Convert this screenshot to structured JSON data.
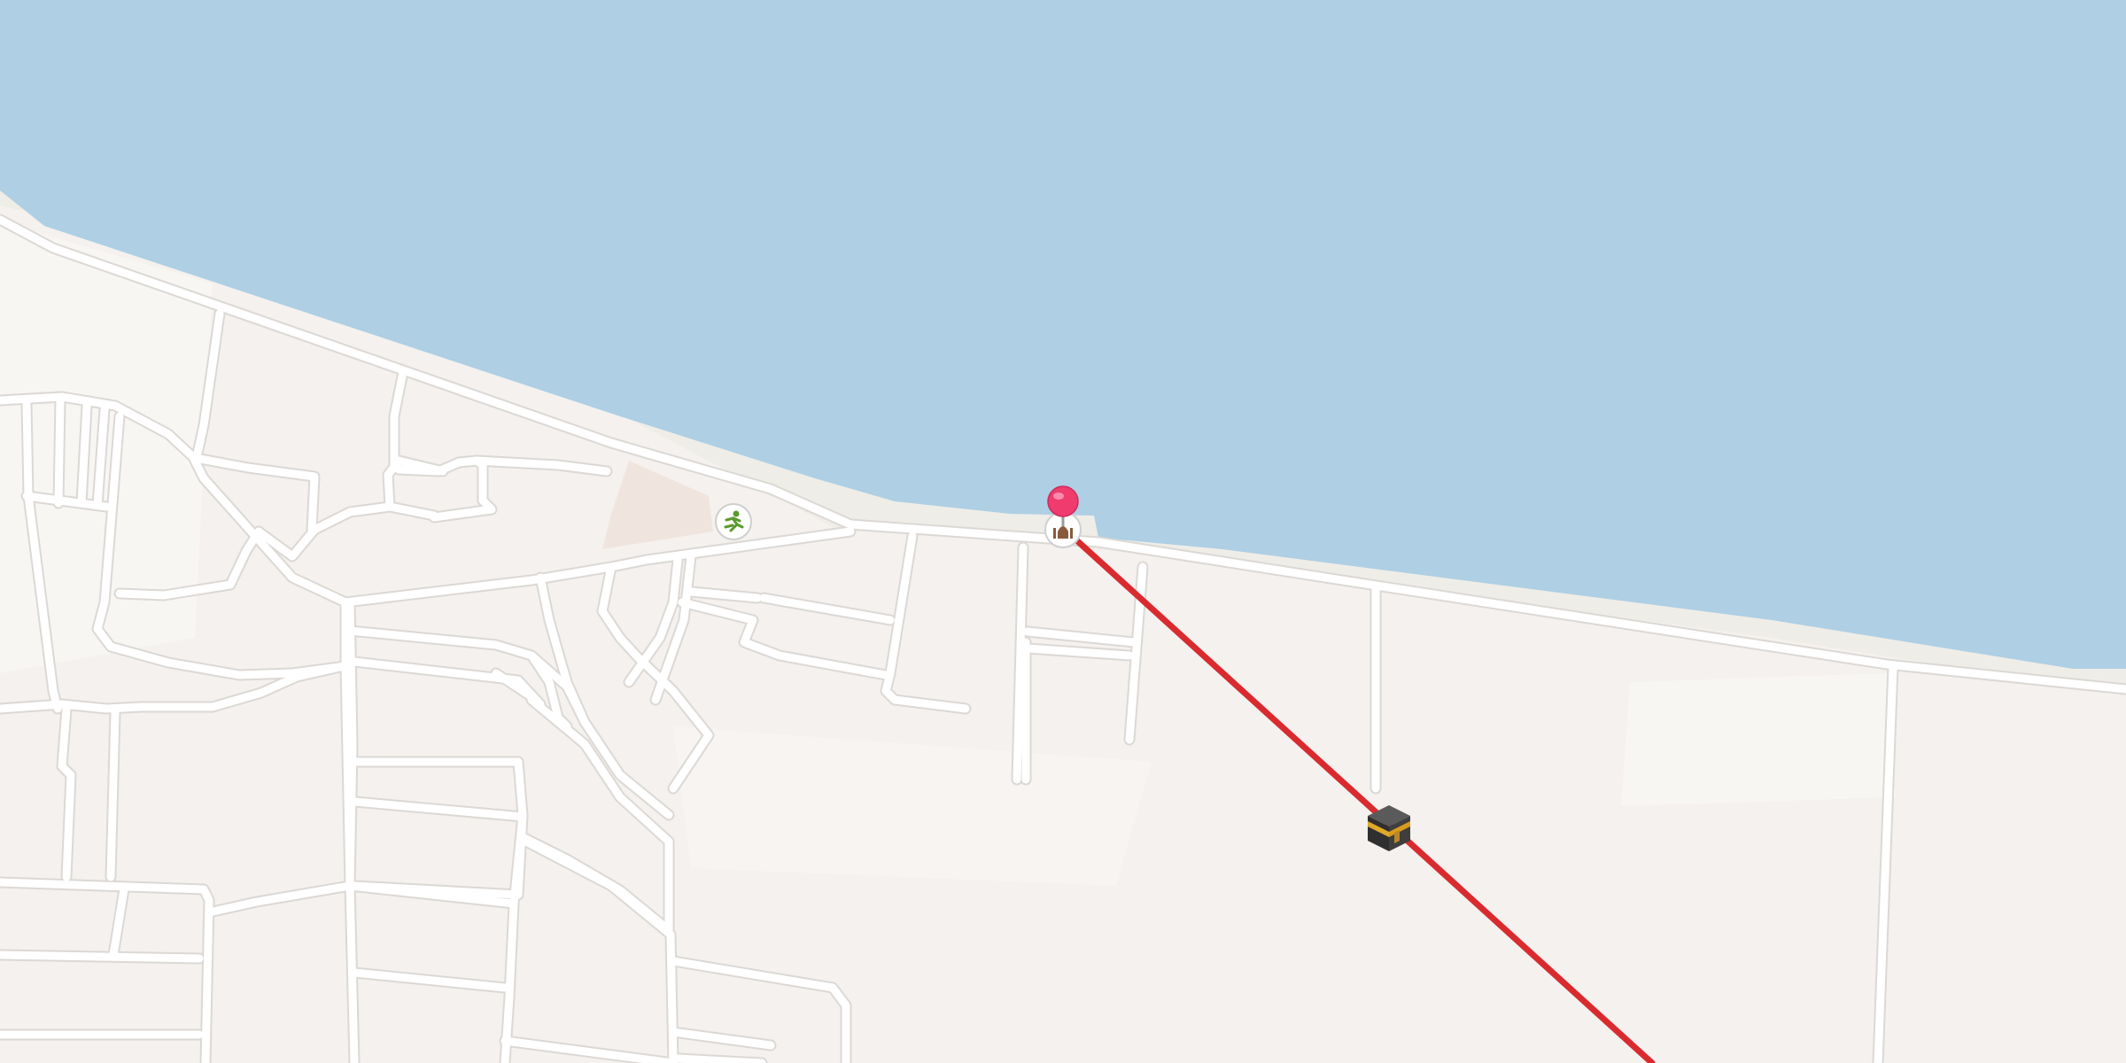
{
  "map": {
    "colors": {
      "water": "#aecfe4",
      "land": "#f4f1ee",
      "land_light": "#f8f6f3",
      "shore": "#efede7",
      "road": "#ffffff",
      "road_casing": "#dcd8d4",
      "bearing_line": "#d92b2f",
      "pin": "#ef3b6e",
      "park_icon": "#5a9a2e"
    },
    "markers": {
      "location_pin": {
        "icon": "location-pin-icon"
      },
      "mosque_poi": {
        "icon": "mosque-icon"
      },
      "sports_poi": {
        "icon": "running-person-icon"
      },
      "kaaba": {
        "icon": "kaaba-icon"
      }
    },
    "bearing_line": {
      "label": "qibla-direction-line"
    }
  }
}
